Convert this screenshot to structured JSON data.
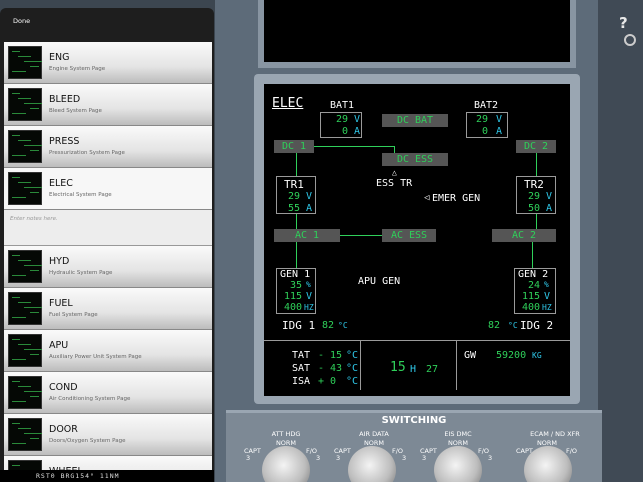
{
  "drawer": {
    "done_label": "Done",
    "notes_placeholder": "Enter notes here.",
    "items": [
      {
        "title": "ENG",
        "subtitle": "Engine System Page"
      },
      {
        "title": "BLEED",
        "subtitle": "Bleed System Page"
      },
      {
        "title": "PRESS",
        "subtitle": "Pressurization System Page"
      },
      {
        "title": "ELEC",
        "subtitle": "Electrical System Page",
        "selected": true
      },
      {
        "title": "HYD",
        "subtitle": "Hydraulic System Page"
      },
      {
        "title": "FUEL",
        "subtitle": "Fuel System Page"
      },
      {
        "title": "APU",
        "subtitle": "Auxiliary Power Unit System Page"
      },
      {
        "title": "COND",
        "subtitle": "Air Conditioning System Page"
      },
      {
        "title": "DOOR",
        "subtitle": "Doors/Oxygen System Page"
      },
      {
        "title": "WHEEL",
        "subtitle": ""
      }
    ],
    "status_text": "RST0   BRG154°  11NM"
  },
  "ecam": {
    "page_title": "ELEC",
    "bat1": {
      "label": "BAT1",
      "volt": "29",
      "volt_unit": "V",
      "amp": "0",
      "amp_unit": "A"
    },
    "bat2": {
      "label": "BAT2",
      "volt": "29",
      "volt_unit": "V",
      "amp": "0",
      "amp_unit": "A"
    },
    "dc_bat": "DC BAT",
    "dc1": "DC 1",
    "dc2": "DC 2",
    "dc_ess": "DC ESS",
    "ess_tr": "ESS TR",
    "emer_gen": "EMER GEN",
    "tr1": {
      "label": "TR",
      "num": "1",
      "volt": "29",
      "volt_unit": "V",
      "amp": "55",
      "amp_unit": "A"
    },
    "tr2": {
      "label": "TR",
      "num": "2",
      "volt": "29",
      "volt_unit": "V",
      "amp": "50",
      "amp_unit": "A"
    },
    "ac1": "AC 1",
    "ac2": "AC 2",
    "ac_ess": "AC ESS",
    "gen1": {
      "label": "GEN",
      "num": "1",
      "load": "35",
      "load_unit": "%",
      "volt": "115",
      "volt_unit": "V",
      "freq": "400",
      "freq_unit": "HZ"
    },
    "gen2": {
      "label": "GEN",
      "num": "2",
      "load": "24",
      "load_unit": "%",
      "volt": "115",
      "volt_unit": "V",
      "freq": "400",
      "freq_unit": "HZ"
    },
    "apu_gen": "APU GEN",
    "idg1": {
      "label": "IDG",
      "num": "1",
      "temp": "82",
      "unit": "°C"
    },
    "idg2": {
      "label": "IDG",
      "num": "2",
      "temp": "82",
      "unit": "°C"
    },
    "tat": {
      "label": "TAT",
      "value": "- 15",
      "unit": "°C"
    },
    "sat": {
      "label": "SAT",
      "value": "- 43",
      "unit": "°C"
    },
    "isa": {
      "label": "ISA",
      "value": "+ 0",
      "unit": "°C"
    },
    "time_h": "15",
    "time_h_label": "H",
    "time_m": "27",
    "gw_label": "GW",
    "gw_value": "59200",
    "gw_unit": "KG"
  },
  "switching": {
    "title": "SWITCHING",
    "knobs": [
      {
        "name": "ATT HDG",
        "norm": "NORM",
        "left": "CAPT",
        "right": "F/O",
        "lnum": "3",
        "rnum": "3"
      },
      {
        "name": "AIR DATA",
        "norm": "NORM",
        "left": "CAPT",
        "right": "F/O",
        "lnum": "3",
        "rnum": "3"
      },
      {
        "name": "EIS DMC",
        "norm": "NORM",
        "left": "CAPT",
        "right": "F/O",
        "lnum": "3",
        "rnum": "3"
      },
      {
        "name": "ECAM / ND XFR",
        "norm": "NORM",
        "left": "CAPT",
        "right": "F/O",
        "lnum": "",
        "rnum": ""
      }
    ]
  },
  "help_label": "?",
  "colors": {
    "ecam_green": "#2fd05a",
    "ecam_cyan": "#2fc7e8",
    "panel": "#5d6b79"
  }
}
